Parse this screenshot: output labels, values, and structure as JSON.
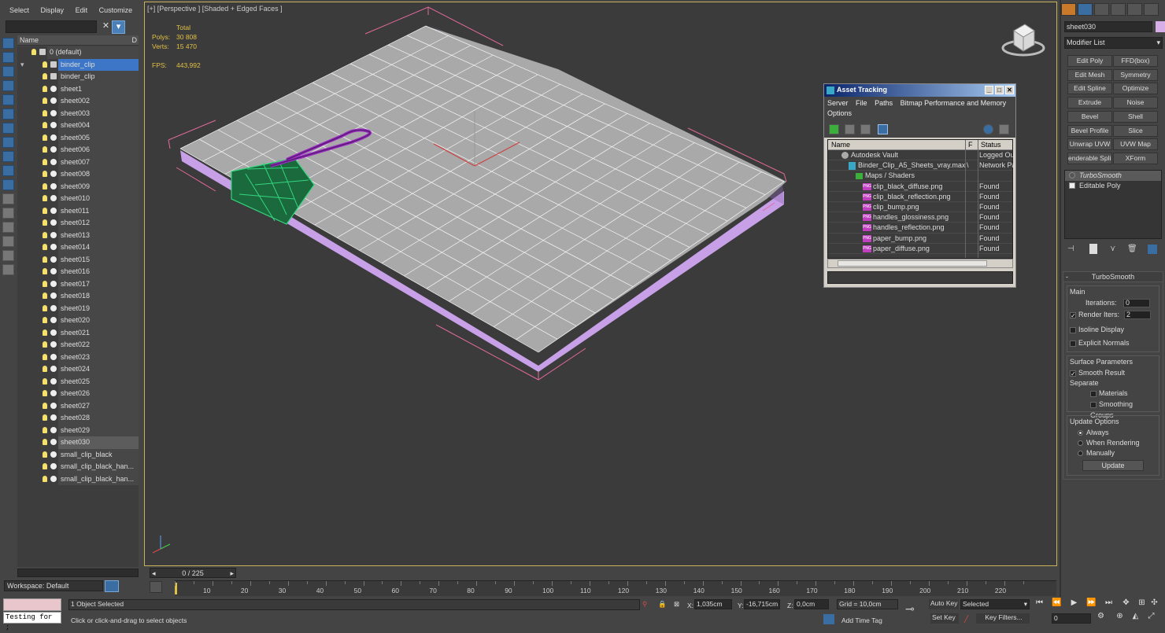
{
  "explorer": {
    "menu": [
      "Select",
      "Display",
      "Edit",
      "Customize"
    ],
    "header_name": "Name",
    "header_col2": "D",
    "items": [
      {
        "label": "0 (default)",
        "indent": 0,
        "kind": "layer",
        "state": ""
      },
      {
        "label": "binder_clip",
        "indent": 1,
        "kind": "layer",
        "state": "sel"
      },
      {
        "label": "binder_clip",
        "indent": 2,
        "kind": "obj",
        "state": ""
      },
      {
        "label": "sheet1",
        "indent": 2,
        "kind": "obj",
        "state": ""
      },
      {
        "label": "sheet002",
        "indent": 2,
        "kind": "obj",
        "state": ""
      },
      {
        "label": "sheet003",
        "indent": 2,
        "kind": "obj",
        "state": ""
      },
      {
        "label": "sheet004",
        "indent": 2,
        "kind": "obj",
        "state": ""
      },
      {
        "label": "sheet005",
        "indent": 2,
        "kind": "obj",
        "state": ""
      },
      {
        "label": "sheet006",
        "indent": 2,
        "kind": "obj",
        "state": ""
      },
      {
        "label": "sheet007",
        "indent": 2,
        "kind": "obj",
        "state": ""
      },
      {
        "label": "sheet008",
        "indent": 2,
        "kind": "obj",
        "state": ""
      },
      {
        "label": "sheet009",
        "indent": 2,
        "kind": "obj",
        "state": ""
      },
      {
        "label": "sheet010",
        "indent": 2,
        "kind": "obj",
        "state": ""
      },
      {
        "label": "sheet011",
        "indent": 2,
        "kind": "obj",
        "state": ""
      },
      {
        "label": "sheet012",
        "indent": 2,
        "kind": "obj",
        "state": ""
      },
      {
        "label": "sheet013",
        "indent": 2,
        "kind": "obj",
        "state": ""
      },
      {
        "label": "sheet014",
        "indent": 2,
        "kind": "obj",
        "state": ""
      },
      {
        "label": "sheet015",
        "indent": 2,
        "kind": "obj",
        "state": ""
      },
      {
        "label": "sheet016",
        "indent": 2,
        "kind": "obj",
        "state": ""
      },
      {
        "label": "sheet017",
        "indent": 2,
        "kind": "obj",
        "state": ""
      },
      {
        "label": "sheet018",
        "indent": 2,
        "kind": "obj",
        "state": ""
      },
      {
        "label": "sheet019",
        "indent": 2,
        "kind": "obj",
        "state": ""
      },
      {
        "label": "sheet020",
        "indent": 2,
        "kind": "obj",
        "state": ""
      },
      {
        "label": "sheet021",
        "indent": 2,
        "kind": "obj",
        "state": ""
      },
      {
        "label": "sheet022",
        "indent": 2,
        "kind": "obj",
        "state": ""
      },
      {
        "label": "sheet023",
        "indent": 2,
        "kind": "obj",
        "state": ""
      },
      {
        "label": "sheet024",
        "indent": 2,
        "kind": "obj",
        "state": ""
      },
      {
        "label": "sheet025",
        "indent": 2,
        "kind": "obj",
        "state": ""
      },
      {
        "label": "sheet026",
        "indent": 2,
        "kind": "obj",
        "state": ""
      },
      {
        "label": "sheet027",
        "indent": 2,
        "kind": "obj",
        "state": ""
      },
      {
        "label": "sheet028",
        "indent": 2,
        "kind": "obj",
        "state": ""
      },
      {
        "label": "sheet029",
        "indent": 2,
        "kind": "obj",
        "state": ""
      },
      {
        "label": "sheet030",
        "indent": 2,
        "kind": "obj",
        "state": "hl"
      },
      {
        "label": "small_clip_black",
        "indent": 2,
        "kind": "obj",
        "state": ""
      },
      {
        "label": "small_clip_black_han...",
        "indent": 2,
        "kind": "obj",
        "state": ""
      },
      {
        "label": "small_clip_black_han...",
        "indent": 2,
        "kind": "obj",
        "state": ""
      }
    ],
    "workspace": "Workspace: Default"
  },
  "viewport": {
    "label": "[+] [Perspective ] [Shaded + Edged Faces ]",
    "stats_total": "Total",
    "polys_label": "Polys:",
    "polys_value": "30 808",
    "verts_label": "Verts:",
    "verts_value": "15 470",
    "fps_label": "FPS:",
    "fps_value": "443,992"
  },
  "asset_tracking": {
    "title": "Asset Tracking",
    "menu": [
      "Server",
      "File",
      "Paths",
      "Bitmap Performance and Memory",
      "Options"
    ],
    "col_name": "Name",
    "col_f": "F",
    "col_status": "Status",
    "rows": [
      {
        "name": "Autodesk Vault",
        "icon": "vault",
        "indent": 1,
        "f": "",
        "status": "Logged Out"
      },
      {
        "name": "Binder_Clip_A5_Sheets_vray.max",
        "icon": "max",
        "indent": 2,
        "f": "\\",
        "status": "Network Path"
      },
      {
        "name": "Maps / Shaders",
        "icon": "folder",
        "indent": 3,
        "f": "",
        "status": ""
      },
      {
        "name": "clip_black_diffuse.png",
        "icon": "png",
        "indent": 4,
        "f": "",
        "status": "Found"
      },
      {
        "name": "clip_black_reflection.png",
        "icon": "png",
        "indent": 4,
        "f": "",
        "status": "Found"
      },
      {
        "name": "clip_bump.png",
        "icon": "png",
        "indent": 4,
        "f": "",
        "status": "Found"
      },
      {
        "name": "handles_glossiness.png",
        "icon": "png",
        "indent": 4,
        "f": "",
        "status": "Found"
      },
      {
        "name": "handles_reflection.png",
        "icon": "png",
        "indent": 4,
        "f": "",
        "status": "Found"
      },
      {
        "name": "paper_bump.png",
        "icon": "png",
        "indent": 4,
        "f": "",
        "status": "Found"
      },
      {
        "name": "paper_diffuse.png",
        "icon": "png",
        "indent": 4,
        "f": "",
        "status": "Found"
      }
    ]
  },
  "command_panel": {
    "object_name": "sheet030",
    "object_color": "#d7aee8",
    "modifier_list": "Modifier List",
    "modifiers": [
      "Edit Poly",
      "FFD(box)",
      "Edit Mesh",
      "Symmetry",
      "Edit Spline",
      "Optimize",
      "Extrude",
      "Noise",
      "Bevel",
      "Shell",
      "Bevel Profile",
      "Slice",
      "Unwrap UVW",
      "UVW Map",
      "enderable Splin",
      "XForm"
    ],
    "stack": [
      "TurboSmooth",
      "Editable Poly"
    ],
    "rollout_title": "TurboSmooth",
    "main_title": "Main",
    "iterations_label": "Iterations:",
    "iterations_value": "0",
    "render_iters_label": "Render Iters:",
    "render_iters_value": "2",
    "isoline_label": "Isoline Display",
    "explicit_label": "Explicit Normals",
    "surface_title": "Surface Parameters",
    "smooth_result_label": "Smooth Result",
    "separate_label": "Separate",
    "materials_label": "Materials",
    "smoothing_groups_label": "Smoothing Groups",
    "update_title": "Update Options",
    "always_label": "Always",
    "when_rendering_label": "When Rendering",
    "manually_label": "Manually",
    "update_button": "Update"
  },
  "timeline": {
    "frame_counter": "0 / 225",
    "ticks": [
      "10",
      "20",
      "30",
      "40",
      "50",
      "60",
      "70",
      "80",
      "90",
      "100",
      "110",
      "120",
      "130",
      "140",
      "150",
      "160",
      "170",
      "180",
      "190",
      "200",
      "210",
      "220"
    ]
  },
  "status": {
    "maxscript_text": "Testing for ;",
    "selection": "1 Object Selected",
    "prompt": "Click or click-and-drag to select objects",
    "x_label": "X:",
    "x_value": "1,035cm",
    "y_label": "Y:",
    "y_value": "-16,715cm",
    "z_label": "Z:",
    "z_value": "0,0cm",
    "grid": "Grid = 10,0cm",
    "add_time_tag": "Add Time Tag",
    "auto_key": "Auto Key",
    "set_key": "Set Key",
    "selected_dropdown": "Selected",
    "key_filters": "Key Filters...",
    "frame_value": "0"
  },
  "colors": {
    "paper_top": "#a9a9a9",
    "paper_side": "#c7a0e8",
    "clip_wire": "#34d67e",
    "handle": "#8a2aa8",
    "selection_blue": "#3d76c6"
  }
}
